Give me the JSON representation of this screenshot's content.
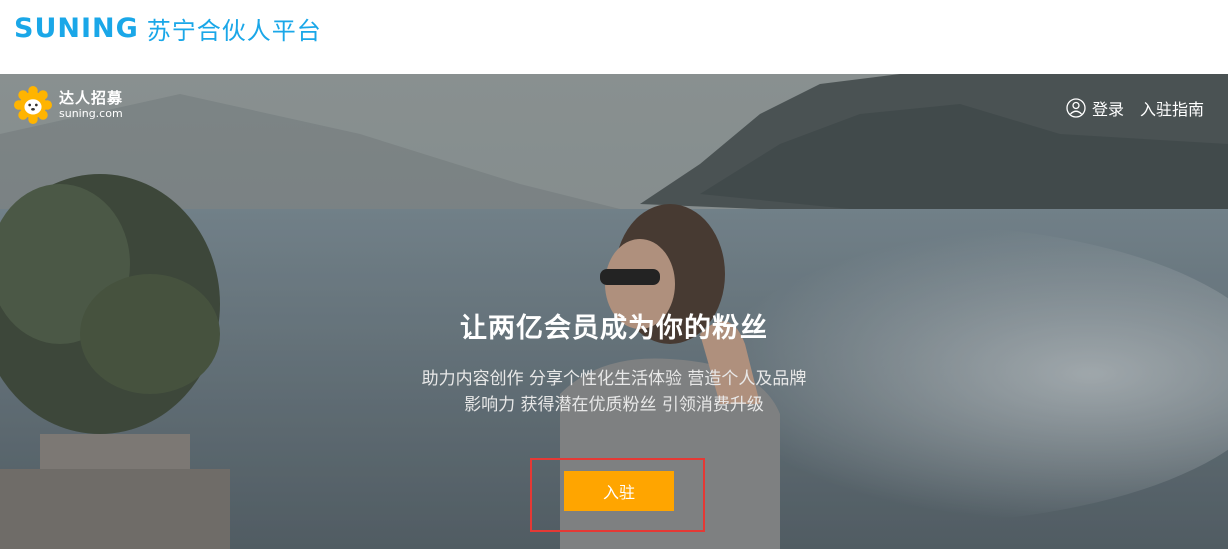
{
  "header": {
    "brand_en": "SUNING",
    "brand_cn": "苏宁合伙人平台"
  },
  "hero": {
    "logo_title": "达人招募",
    "logo_domain": "suning.com",
    "nav": {
      "login": "登录",
      "guide": "入驻指南"
    },
    "headline": "让两亿会员成为你的粉丝",
    "subline1": "助力内容创作 分享个性化生活体验 营造个人及品牌",
    "subline2": "影响力 获得潜在优质粉丝 引领消费升级",
    "cta": "入驻"
  },
  "colors": {
    "brand_blue": "#1aa7e8",
    "cta_orange": "#ffa500",
    "highlight_red": "#e53935",
    "lion_yellow": "#ffb400"
  },
  "icons": [
    "lion-logo-icon",
    "user-circle-icon"
  ]
}
